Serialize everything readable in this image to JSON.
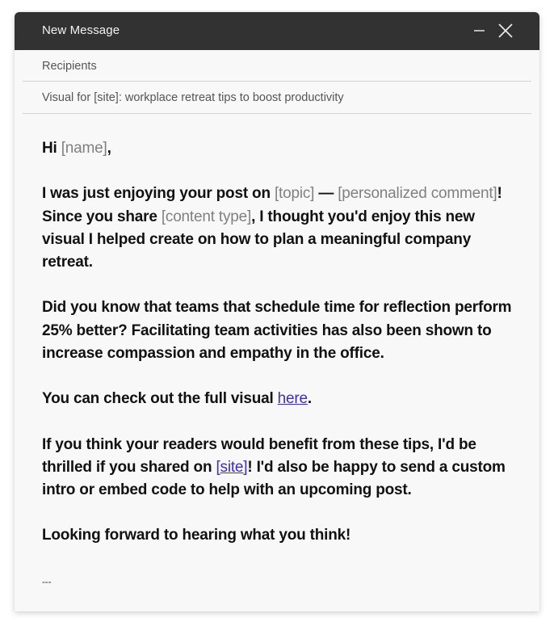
{
  "window": {
    "title": "New Message",
    "controls": [
      {
        "name": "minimize",
        "icon": "minus-icon"
      },
      {
        "name": "close",
        "icon": "close-icon"
      }
    ]
  },
  "fields": {
    "recipients_placeholder": "Recipients",
    "subject": "Visual for [site]: workplace retreat tips to boost productivity"
  },
  "body": {
    "greeting": {
      "hi": "Hi ",
      "name": "[name]",
      "comma": ","
    },
    "para1": {
      "t1": "I was just enjoying your post on ",
      "topic": "[topic]",
      "t2": " — ",
      "comment": "[personalized comment]",
      "t3": "! Since you share ",
      "content_type": "[content type]",
      "t4": ", I thought you'd enjoy this new visual I helped create on how to plan a meaningful company retreat."
    },
    "para2": "Did you know that teams that schedule time for reflection perform 25% better? Facilitating team activities has also been shown to increase compassion and empathy in the office.",
    "para3": {
      "t1": "You can check out the full visual ",
      "link": "here",
      "t2": "."
    },
    "para4": {
      "t1": "If you think your readers would benefit from these tips, I'd be thrilled if you shared on ",
      "link": "[site]",
      "t2": "! I'd also be happy to send a custom intro or embed code to help with an upcoming post."
    },
    "para5": "Looking forward to hearing what you think!",
    "signature": "---"
  },
  "colors": {
    "titlebar": "#323232",
    "placeholder": "#808080",
    "link": "#3b2bd6"
  }
}
